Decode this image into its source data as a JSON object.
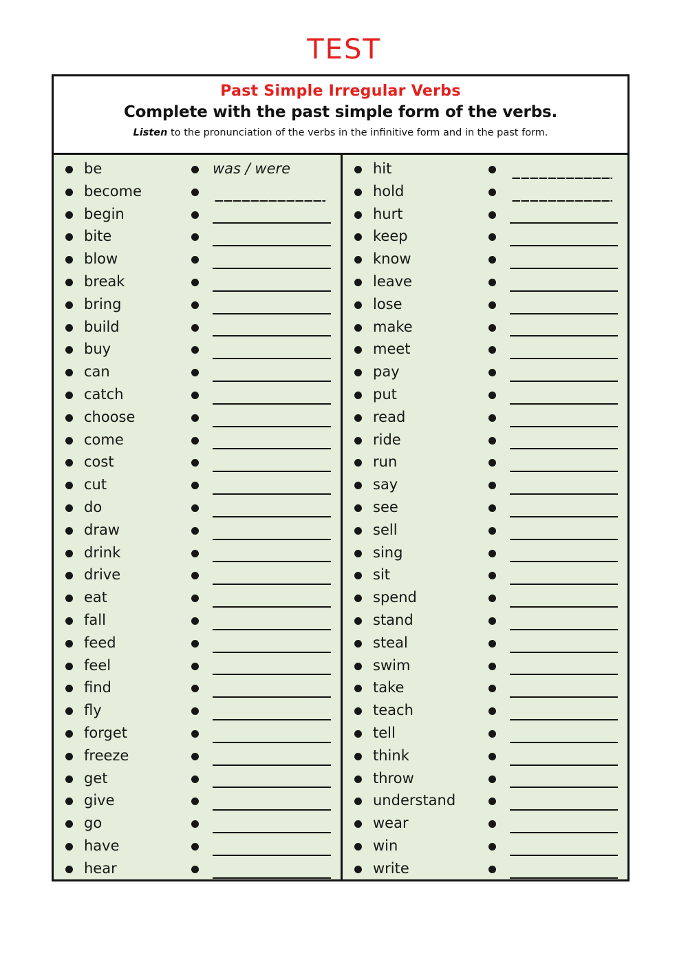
{
  "page": {
    "title": "TEST",
    "title_color": "#e3201c"
  },
  "header": {
    "subject_title": "Past Simple Irregular Verbs",
    "instruction": "Complete with the past simple form of the verbs.",
    "listen_word": "Listen",
    "listen_rest": " to the pronunciation of the verbs in the infinitive form and in the past form.",
    "accent_color": "#e3201c",
    "background_color": "#e4eeda"
  },
  "columns": [
    {
      "name": "left-column",
      "rows": [
        {
          "verb": "be",
          "answer": "was / were",
          "line": "none"
        },
        {
          "verb": "become",
          "answer": "",
          "line": "dashed"
        },
        {
          "verb": "begin",
          "answer": "",
          "line": "solid"
        },
        {
          "verb": "bite",
          "answer": "",
          "line": "solid"
        },
        {
          "verb": "blow",
          "answer": "",
          "line": "solid"
        },
        {
          "verb": "break",
          "answer": "",
          "line": "solid"
        },
        {
          "verb": "bring",
          "answer": "",
          "line": "solid"
        },
        {
          "verb": "build",
          "answer": "",
          "line": "solid"
        },
        {
          "verb": "buy",
          "answer": "",
          "line": "solid"
        },
        {
          "verb": "can",
          "answer": "",
          "line": "solid"
        },
        {
          "verb": "catch",
          "answer": "",
          "line": "solid"
        },
        {
          "verb": "choose",
          "answer": "",
          "line": "solid"
        },
        {
          "verb": "come",
          "answer": "",
          "line": "solid"
        },
        {
          "verb": "cost",
          "answer": "",
          "line": "solid"
        },
        {
          "verb": "cut",
          "answer": "",
          "line": "solid"
        },
        {
          "verb": "do",
          "answer": "",
          "line": "solid"
        },
        {
          "verb": "draw",
          "answer": "",
          "line": "solid"
        },
        {
          "verb": "drink",
          "answer": "",
          "line": "solid"
        },
        {
          "verb": "drive",
          "answer": "",
          "line": "solid"
        },
        {
          "verb": "eat",
          "answer": "",
          "line": "solid"
        },
        {
          "verb": "fall",
          "answer": "",
          "line": "solid"
        },
        {
          "verb": "feed",
          "answer": "",
          "line": "solid"
        },
        {
          "verb": "feel",
          "answer": "",
          "line": "solid"
        },
        {
          "verb": "find",
          "answer": "",
          "line": "solid"
        },
        {
          "verb": "fly",
          "answer": "",
          "line": "solid"
        },
        {
          "verb": "forget",
          "answer": "",
          "line": "solid"
        },
        {
          "verb": "freeze",
          "answer": "",
          "line": "solid"
        },
        {
          "verb": "get",
          "answer": "",
          "line": "solid"
        },
        {
          "verb": "give",
          "answer": "",
          "line": "solid"
        },
        {
          "verb": "go",
          "answer": "",
          "line": "solid"
        },
        {
          "verb": "have",
          "answer": "",
          "line": "solid"
        },
        {
          "verb": "hear",
          "answer": "",
          "line": "solid"
        }
      ]
    },
    {
      "name": "right-column",
      "rows": [
        {
          "verb": "hit",
          "answer": "",
          "line": "dashed"
        },
        {
          "verb": "hold",
          "answer": "",
          "line": "dashed"
        },
        {
          "verb": "hurt",
          "answer": "",
          "line": "solid"
        },
        {
          "verb": "keep",
          "answer": "",
          "line": "solid"
        },
        {
          "verb": "know",
          "answer": "",
          "line": "solid"
        },
        {
          "verb": "leave",
          "answer": "",
          "line": "solid"
        },
        {
          "verb": "lose",
          "answer": "",
          "line": "solid"
        },
        {
          "verb": "make",
          "answer": "",
          "line": "solid"
        },
        {
          "verb": "meet",
          "answer": "",
          "line": "solid"
        },
        {
          "verb": "pay",
          "answer": "",
          "line": "solid"
        },
        {
          "verb": "put",
          "answer": "",
          "line": "solid"
        },
        {
          "verb": "read",
          "answer": "",
          "line": "solid"
        },
        {
          "verb": "ride",
          "answer": "",
          "line": "solid"
        },
        {
          "verb": "run",
          "answer": "",
          "line": "solid"
        },
        {
          "verb": "say",
          "answer": "",
          "line": "solid"
        },
        {
          "verb": "see",
          "answer": "",
          "line": "solid"
        },
        {
          "verb": "sell",
          "answer": "",
          "line": "solid"
        },
        {
          "verb": "sing",
          "answer": "",
          "line": "solid"
        },
        {
          "verb": "sit",
          "answer": "",
          "line": "solid"
        },
        {
          "verb": "spend",
          "answer": "",
          "line": "solid"
        },
        {
          "verb": "stand",
          "answer": "",
          "line": "solid"
        },
        {
          "verb": "steal",
          "answer": "",
          "line": "solid"
        },
        {
          "verb": "swim",
          "answer": "",
          "line": "solid"
        },
        {
          "verb": "take",
          "answer": "",
          "line": "solid"
        },
        {
          "verb": "teach",
          "answer": "",
          "line": "solid"
        },
        {
          "verb": "tell",
          "answer": "",
          "line": "solid"
        },
        {
          "verb": "think",
          "answer": "",
          "line": "solid"
        },
        {
          "verb": "throw",
          "answer": "",
          "line": "solid"
        },
        {
          "verb": "understand",
          "answer": "",
          "line": "solid"
        },
        {
          "verb": "wear",
          "answer": "",
          "line": "solid"
        },
        {
          "verb": "win",
          "answer": "",
          "line": "solid"
        },
        {
          "verb": "write",
          "answer": "",
          "line": "solid"
        }
      ]
    }
  ]
}
